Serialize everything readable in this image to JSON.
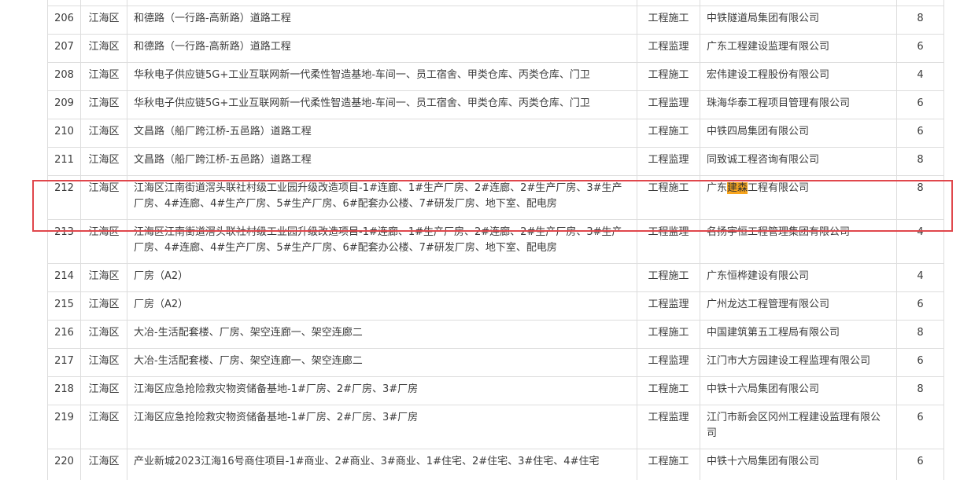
{
  "rows": [
    {
      "no": "206",
      "district": "江海区",
      "name": "和德路（一行路-高新路）道路工程",
      "type": "工程施工",
      "company": "中铁隧道局集团有限公司",
      "score": "8"
    },
    {
      "no": "207",
      "district": "江海区",
      "name": "和德路（一行路-高新路）道路工程",
      "type": "工程监理",
      "company": "广东工程建设监理有限公司",
      "score": "6"
    },
    {
      "no": "208",
      "district": "江海区",
      "name": "华秋电子供应链5G+工业互联网新一代柔性智造基地-车间一、员工宿舍、甲类仓库、丙类仓库、门卫",
      "type": "工程施工",
      "company": "宏伟建设工程股份有限公司",
      "score": "4"
    },
    {
      "no": "209",
      "district": "江海区",
      "name": "华秋电子供应链5G+工业互联网新一代柔性智造基地-车间一、员工宿舍、甲类仓库、丙类仓库、门卫",
      "type": "工程监理",
      "company": "珠海华泰工程项目管理有限公司",
      "score": "6"
    },
    {
      "no": "210",
      "district": "江海区",
      "name": "文昌路（船厂跨江桥-五邑路）道路工程",
      "type": "工程施工",
      "company": "中铁四局集团有限公司",
      "score": "6"
    },
    {
      "no": "211",
      "district": "江海区",
      "name": "文昌路（船厂跨江桥-五邑路）道路工程",
      "type": "工程监理",
      "company": "同致诚工程咨询有限公司",
      "score": "8"
    },
    {
      "no": "212",
      "district": "江海区",
      "name": "江海区江南街道滘头联社村级工业园升级改造项目-1#连廊、1#生产厂房、2#连廊、2#生产厂房、3#生产厂房、4#连廊、4#生产厂房、5#生产厂房、6#配套办公楼、7#研发厂房、地下室、配电房",
      "type": "工程施工",
      "company_pre": "广东",
      "company_hl": "建森",
      "company_post": "工程有限公司",
      "score": "8"
    },
    {
      "no": "213",
      "district": "江海区",
      "name": "江海区江南街道滘头联社村级工业园升级改造项目-1#连廊、1#生产厂房、2#连廊、2#生产厂房、3#生产厂房、4#连廊、4#生产厂房、5#生产厂房、6#配套办公楼、7#研发厂房、地下室、配电房",
      "type": "工程监理",
      "company": "名扬宇恒工程管理集团有限公司",
      "score": "4"
    },
    {
      "no": "214",
      "district": "江海区",
      "name": "厂房（A2）",
      "type": "工程施工",
      "company": "广东恒桦建设有限公司",
      "score": "4"
    },
    {
      "no": "215",
      "district": "江海区",
      "name": "厂房（A2）",
      "type": "工程监理",
      "company": "广州龙达工程管理有限公司",
      "score": "6"
    },
    {
      "no": "216",
      "district": "江海区",
      "name": "大冶-生活配套楼、厂房、架空连廊一、架空连廊二",
      "type": "工程施工",
      "company": "中国建筑第五工程局有限公司",
      "score": "8"
    },
    {
      "no": "217",
      "district": "江海区",
      "name": "大冶-生活配套楼、厂房、架空连廊一、架空连廊二",
      "type": "工程监理",
      "company": "江门市大方园建设工程监理有限公司",
      "score": "6"
    },
    {
      "no": "218",
      "district": "江海区",
      "name": "江海区应急抢险救灾物资储备基地-1#厂房、2#厂房、3#厂房",
      "type": "工程施工",
      "company": "中铁十六局集团有限公司",
      "score": "8"
    },
    {
      "no": "219",
      "district": "江海区",
      "name": "江海区应急抢险救灾物资储备基地-1#厂房、2#厂房、3#厂房",
      "type": "工程监理",
      "company": "江门市新会区冈州工程建设监理有限公司",
      "score": "6"
    },
    {
      "no": "220",
      "district": "江海区",
      "name": "产业新城2023江海16号商住项目-1#商业、2#商业、3#商业、1#住宅、2#住宅、3#住宅、4#住宅",
      "type": "工程施工",
      "company": "中铁十六局集团有限公司",
      "score": "6"
    }
  ],
  "colors": {
    "highlight": "#f7a41d",
    "selection_border": "#e0474c",
    "grid_border": "#dddddd"
  }
}
